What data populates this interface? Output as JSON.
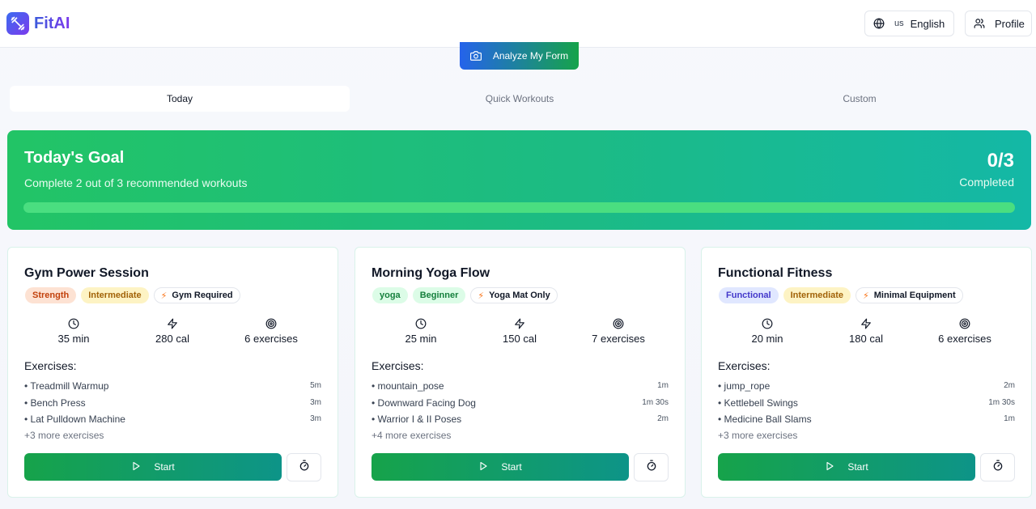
{
  "brand": {
    "name": "FitAI"
  },
  "header": {
    "language_code": "us",
    "language_label": "English",
    "profile_label": "Profile"
  },
  "analyze_label": "Analyze My Form",
  "tabs": [
    {
      "label": "Today",
      "active": true
    },
    {
      "label": "Quick Workouts",
      "active": false
    },
    {
      "label": "Custom",
      "active": false
    }
  ],
  "goal": {
    "title": "Today's Goal",
    "subtitle": "Complete 2 out of 3 recommended workouts",
    "count": "0/3",
    "status": "Completed",
    "progress": 0
  },
  "exercises_heading": "Exercises:",
  "start_label": "Start",
  "workouts": [
    {
      "title": "Gym Power Session",
      "tags": [
        {
          "label": "Strength",
          "bg": "#fde2d3",
          "fg": "#c2410c"
        },
        {
          "label": "Intermediate",
          "bg": "#fdf3c4",
          "fg": "#a16207"
        }
      ],
      "equipment": "Gym Required",
      "duration": "35 min",
      "calories": "280 cal",
      "exercise_count": "6 exercises",
      "exercises": [
        {
          "name": "• Treadmill Warmup",
          "duration": "5m"
        },
        {
          "name": "• Bench Press",
          "duration": "3m"
        },
        {
          "name": "• Lat Pulldown Machine",
          "duration": "3m"
        }
      ],
      "more": "+3 more exercises"
    },
    {
      "title": "Morning Yoga Flow",
      "tags": [
        {
          "label": "yoga",
          "bg": "#dcfce7",
          "fg": "#15803d"
        },
        {
          "label": "Beginner",
          "bg": "#dcfce7",
          "fg": "#15803d"
        }
      ],
      "equipment": "Yoga Mat Only",
      "duration": "25 min",
      "calories": "150 cal",
      "exercise_count": "7 exercises",
      "exercises": [
        {
          "name": "• mountain_pose",
          "duration": "1m"
        },
        {
          "name": "• Downward Facing Dog",
          "duration": "1m 30s"
        },
        {
          "name": "• Warrior I & II Poses",
          "duration": "2m"
        }
      ],
      "more": "+4 more exercises"
    },
    {
      "title": "Functional Fitness",
      "tags": [
        {
          "label": "Functional",
          "bg": "#e0e7ff",
          "fg": "#4338ca"
        },
        {
          "label": "Intermediate",
          "bg": "#fdf3c4",
          "fg": "#a16207"
        }
      ],
      "equipment": "Minimal Equipment",
      "duration": "20 min",
      "calories": "180 cal",
      "exercise_count": "6 exercises",
      "exercises": [
        {
          "name": "• jump_rope",
          "duration": "2m"
        },
        {
          "name": "• Kettlebell Swings",
          "duration": "1m 30s"
        },
        {
          "name": "• Medicine Ball Slams",
          "duration": "1m"
        }
      ],
      "more": "+3 more exercises"
    }
  ],
  "icons": {
    "language": "globe-icon",
    "profile": "users-icon",
    "analyze": "camera-icon",
    "duration": "clock-icon",
    "calories": "zap-icon",
    "exercises": "target-icon",
    "equipment": "bolt-icon",
    "start": "play-icon",
    "timer": "timer-icon"
  }
}
